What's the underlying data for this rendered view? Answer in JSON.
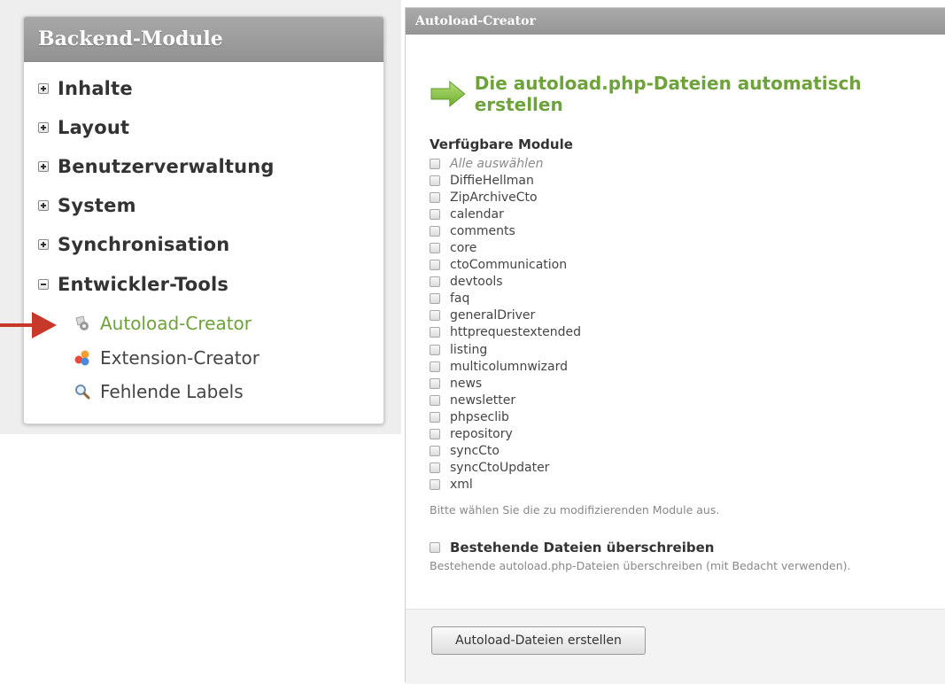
{
  "sidebar": {
    "title": "Backend-Module",
    "groups": [
      {
        "label": "Inhalte",
        "state": "collapsed"
      },
      {
        "label": "Layout",
        "state": "collapsed"
      },
      {
        "label": "Benutzerverwaltung",
        "state": "collapsed"
      },
      {
        "label": "System",
        "state": "collapsed"
      },
      {
        "label": "Synchronisation",
        "state": "collapsed"
      },
      {
        "label": "Entwickler-Tools",
        "state": "expanded"
      }
    ],
    "items": [
      {
        "label": "Autoload-Creator",
        "icon": "autoload-gear-icon",
        "active": true
      },
      {
        "label": "Extension-Creator",
        "icon": "extension-puzzle-icon",
        "active": false
      },
      {
        "label": "Fehlende Labels",
        "icon": "magnifier-icon",
        "active": false
      }
    ],
    "pointer_color": "#c8382a"
  },
  "panel": {
    "title": "Autoload-Creator",
    "headline": "Die autoload.php-Dateien automatisch erstellen",
    "modules_label": "Verfügbare Module",
    "select_all": "Alle auswählen",
    "modules": [
      "DiffieHellman",
      "ZipArchiveCto",
      "calendar",
      "comments",
      "core",
      "ctoCommunication",
      "devtools",
      "faq",
      "generalDriver",
      "httprequestextended",
      "listing",
      "multicolumnwizard",
      "news",
      "newsletter",
      "phpseclib",
      "repository",
      "syncCto",
      "syncCtoUpdater",
      "xml"
    ],
    "modules_hint": "Bitte wählen Sie die zu modifizierenden Module aus.",
    "overwrite_label": "Bestehende Dateien überschreiben",
    "overwrite_hint": "Bestehende autoload.php-Dateien überschreiben (mit Bedacht verwenden).",
    "submit_label": "Autoload-Dateien erstellen"
  },
  "colors": {
    "accent_green": "#6ea23a",
    "header_gray": "#9c9c9c"
  }
}
